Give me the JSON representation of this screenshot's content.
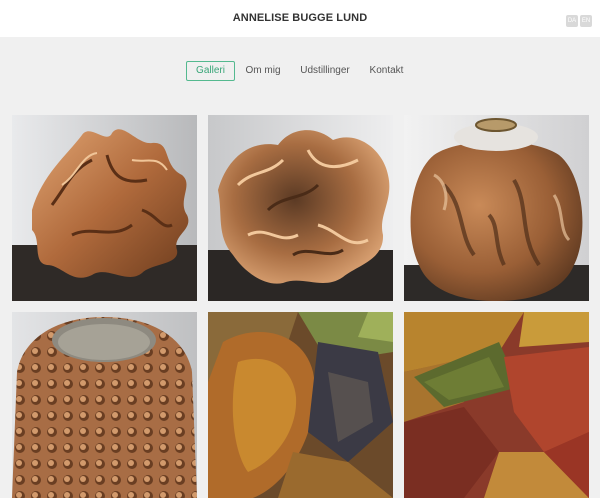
{
  "site": {
    "title": "ANNELISE BUGGE LUND"
  },
  "languages": [
    "DA",
    "EN"
  ],
  "nav": {
    "items": [
      {
        "label": "Galleri",
        "active": true
      },
      {
        "label": "Om mig",
        "active": false
      },
      {
        "label": "Udstillinger",
        "active": false
      },
      {
        "label": "Kontakt",
        "active": false
      }
    ]
  },
  "colors": {
    "accent": "#54b98f",
    "background": "#f0f0f0",
    "header": "#ffffff"
  },
  "gallery": {
    "items": [
      {
        "subject": "ceramic-sculpture-photo"
      },
      {
        "subject": "ceramic-sculpture-photo"
      },
      {
        "subject": "ceramic-vase-photo"
      },
      {
        "subject": "ceramic-bowl-photo"
      },
      {
        "subject": "abstract-painting"
      },
      {
        "subject": "abstract-painting"
      }
    ]
  }
}
